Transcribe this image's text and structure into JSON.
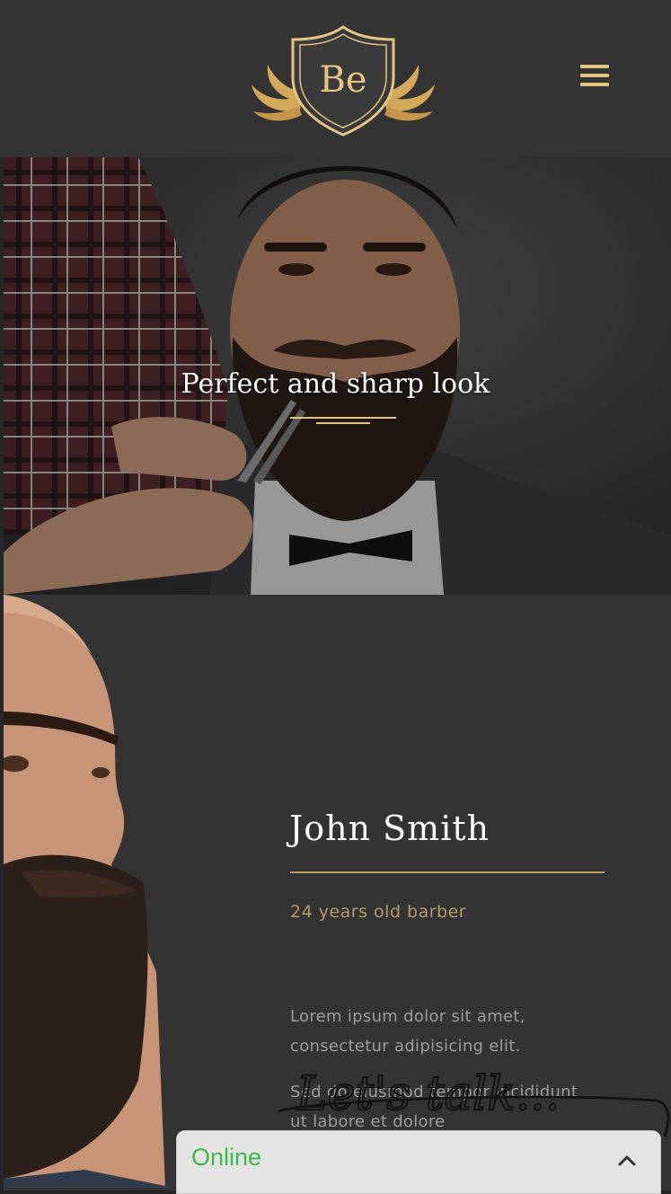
{
  "header": {
    "logo_text": "Be",
    "menu_icon": "hamburger-menu-icon",
    "accent_color": "#e4c386"
  },
  "hero": {
    "title": "Perfect and sharp look"
  },
  "profile": {
    "name": "John Smith",
    "subtitle": "24 years old barber",
    "bio_paragraphs": [
      "Lorem ipsum dolor sit amet, consectetur adipisicing elit.",
      "Sed do eiusmod tempor incididunt ut labore et dolore"
    ]
  },
  "chat_widget": {
    "overlay_text": "Let's talk...",
    "status": "Online",
    "status_color": "#3fb84a",
    "toggle_icon": "chevron-up-icon"
  }
}
